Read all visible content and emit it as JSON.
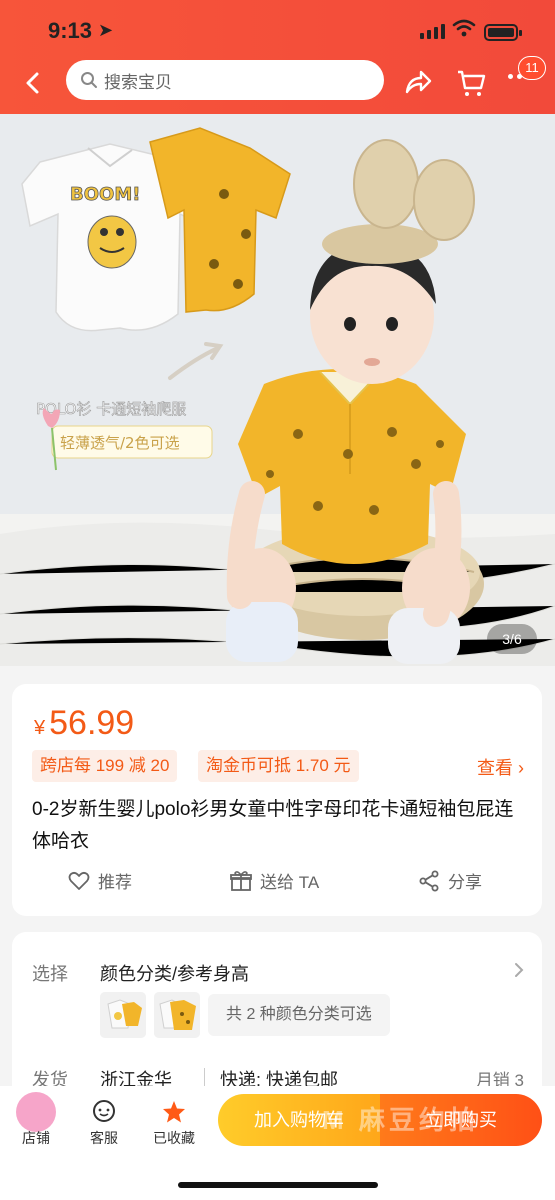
{
  "status_bar": {
    "time": "9:13"
  },
  "header": {
    "search_placeholder": "搜索宝贝",
    "badge_count": "11",
    "icons": [
      "back-icon",
      "search-icon",
      "share-icon",
      "cart-icon",
      "more-icon"
    ]
  },
  "gallery": {
    "overlay_labels": {
      "boom": "BOOM!",
      "line1": "POLO衫 卡通短袖爬服",
      "line2": "轻薄透气/2色可选"
    },
    "counter": "3/6"
  },
  "product": {
    "currency": "¥",
    "price": "56.99",
    "promo_tags": [
      "跨店每 199 减 20",
      "淘金币可抵 1.70 元"
    ],
    "view_label": "查看",
    "title": "0-2岁新生婴儿polo衫男女童中性字母印花卡通短袖包屁连体哈衣",
    "actions": {
      "recommend": "推荐",
      "gift": "送给 TA",
      "share": "分享"
    }
  },
  "options": {
    "select_label": "选择",
    "select_value": "颜色分类/参考身高",
    "more_colors": "共 2 种颜色分类可选",
    "ship_label": "发货",
    "ship_from": "浙江金华",
    "ship_method": "快递: 快递包邮",
    "sales": "月销 3"
  },
  "bottom_bar": {
    "store": "店铺",
    "service": "客服",
    "favorited": "已收藏",
    "add_to_cart": "加入购物车",
    "buy_now": "立即购买",
    "watermark": "M 麻豆约拍"
  },
  "colors": {
    "header": "#f24a3a",
    "accent": "#f35a16",
    "cart_button": "#ffb21f",
    "buy_button": "#ff5a16",
    "romper_yellow": "#f2b52a"
  }
}
